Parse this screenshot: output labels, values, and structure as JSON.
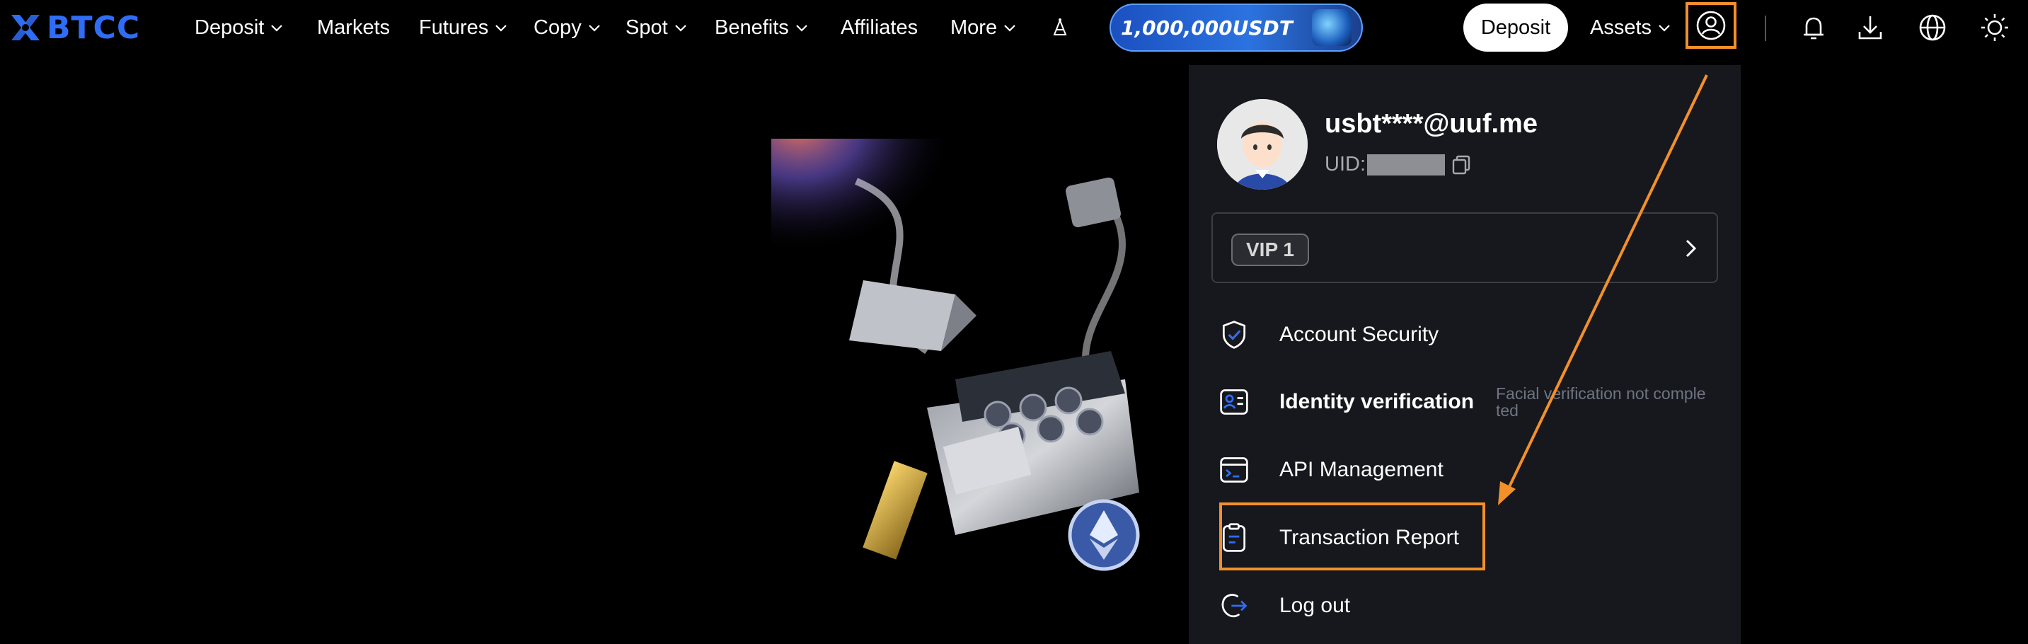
{
  "brand": {
    "name": "BTCC",
    "color": "#2f6df6"
  },
  "nav": {
    "items": [
      {
        "label": "Deposit",
        "dropdown": true
      },
      {
        "label": "Markets",
        "dropdown": false
      },
      {
        "label": "Futures",
        "dropdown": true
      },
      {
        "label": "Copy",
        "dropdown": true
      },
      {
        "label": "Spot",
        "dropdown": true
      },
      {
        "label": "Benefits",
        "dropdown": true
      },
      {
        "label": "Affiliates",
        "dropdown": false
      },
      {
        "label": "More",
        "dropdown": true
      }
    ],
    "promo_label": "1,000,000USDT",
    "deposit_button": "Deposit",
    "assets_label": "Assets",
    "icons": [
      "user-icon",
      "bell-icon",
      "download-icon",
      "globe-icon",
      "sun-icon"
    ]
  },
  "user_menu": {
    "email": "usbt****@uuf.me",
    "uid_label": "UID:",
    "vip_label": "VIP 1",
    "items": [
      {
        "label": "Account Security",
        "icon": "shield-check-icon"
      },
      {
        "label": "Identity verification",
        "icon": "id-card-icon",
        "note": "Facial verification not completed"
      },
      {
        "label": "API Management",
        "icon": "terminal-icon"
      },
      {
        "label": "Transaction Report",
        "icon": "report-icon",
        "highlighted": true
      },
      {
        "label": "Log out",
        "icon": "logout-icon"
      }
    ]
  },
  "colors": {
    "background": "#000000",
    "panel": "#16181d",
    "accent": "#2f6df6",
    "highlight": "#f3902a"
  }
}
